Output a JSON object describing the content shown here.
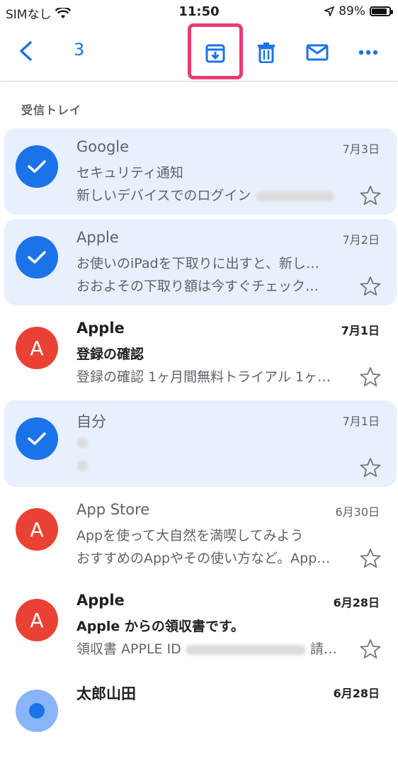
{
  "status_bar": {
    "carrier": "SIMなし",
    "time": "11:50",
    "battery_percent": "89%",
    "battery_level": 0.89
  },
  "toolbar": {
    "selected_count": "3"
  },
  "highlight_color": "#ea3a78",
  "accent_color": "#1a73e8",
  "section_label": "受信トレイ",
  "emails": [
    {
      "sender": "Google",
      "date": "7月3日",
      "subject": "セキュリティ通知",
      "snippet": "新しいデバイスでのログイン",
      "selected": true,
      "unread": false,
      "avatar_letter": ""
    },
    {
      "sender": "Apple",
      "date": "7月2日",
      "subject": "お使いのiPadを下取りに出すと、新し…",
      "snippet": "おおよその下取り額は今すぐチェック…",
      "selected": true,
      "unread": false,
      "avatar_letter": ""
    },
    {
      "sender": "Apple",
      "date": "7月1日",
      "subject": "登録の確認",
      "snippet": "登録の確認 1ヶ月間無料トライアル 1ヶ…",
      "selected": false,
      "unread": true,
      "avatar_letter": "A"
    },
    {
      "sender": "自分",
      "date": "7月1日",
      "subject": "",
      "snippet": "",
      "selected": true,
      "unread": false,
      "avatar_letter": ""
    },
    {
      "sender": "App Store",
      "date": "6月30日",
      "subject": "Appを使って大自然を満喫してみよう",
      "snippet": "おすすめのAppやその使い方など。App…",
      "selected": false,
      "unread": false,
      "avatar_letter": "A"
    },
    {
      "sender": "Apple",
      "date": "6月28日",
      "subject": "Apple からの領収書です。",
      "snippet": "領収書 APPLE ID",
      "snippet_end": "請…",
      "selected": false,
      "unread": true,
      "avatar_letter": "A"
    },
    {
      "sender": "太郎山田",
      "date": "6月28日",
      "subject": "",
      "snippet": "",
      "selected": false,
      "unread": true,
      "avatar_letter": ""
    }
  ],
  "icons": [
    "back-arrow-icon",
    "archive-icon",
    "trash-icon",
    "mail-icon",
    "more-dots-icon",
    "check-icon",
    "star-icon",
    "wifi-icon",
    "location-arrow-icon",
    "battery-icon"
  ]
}
